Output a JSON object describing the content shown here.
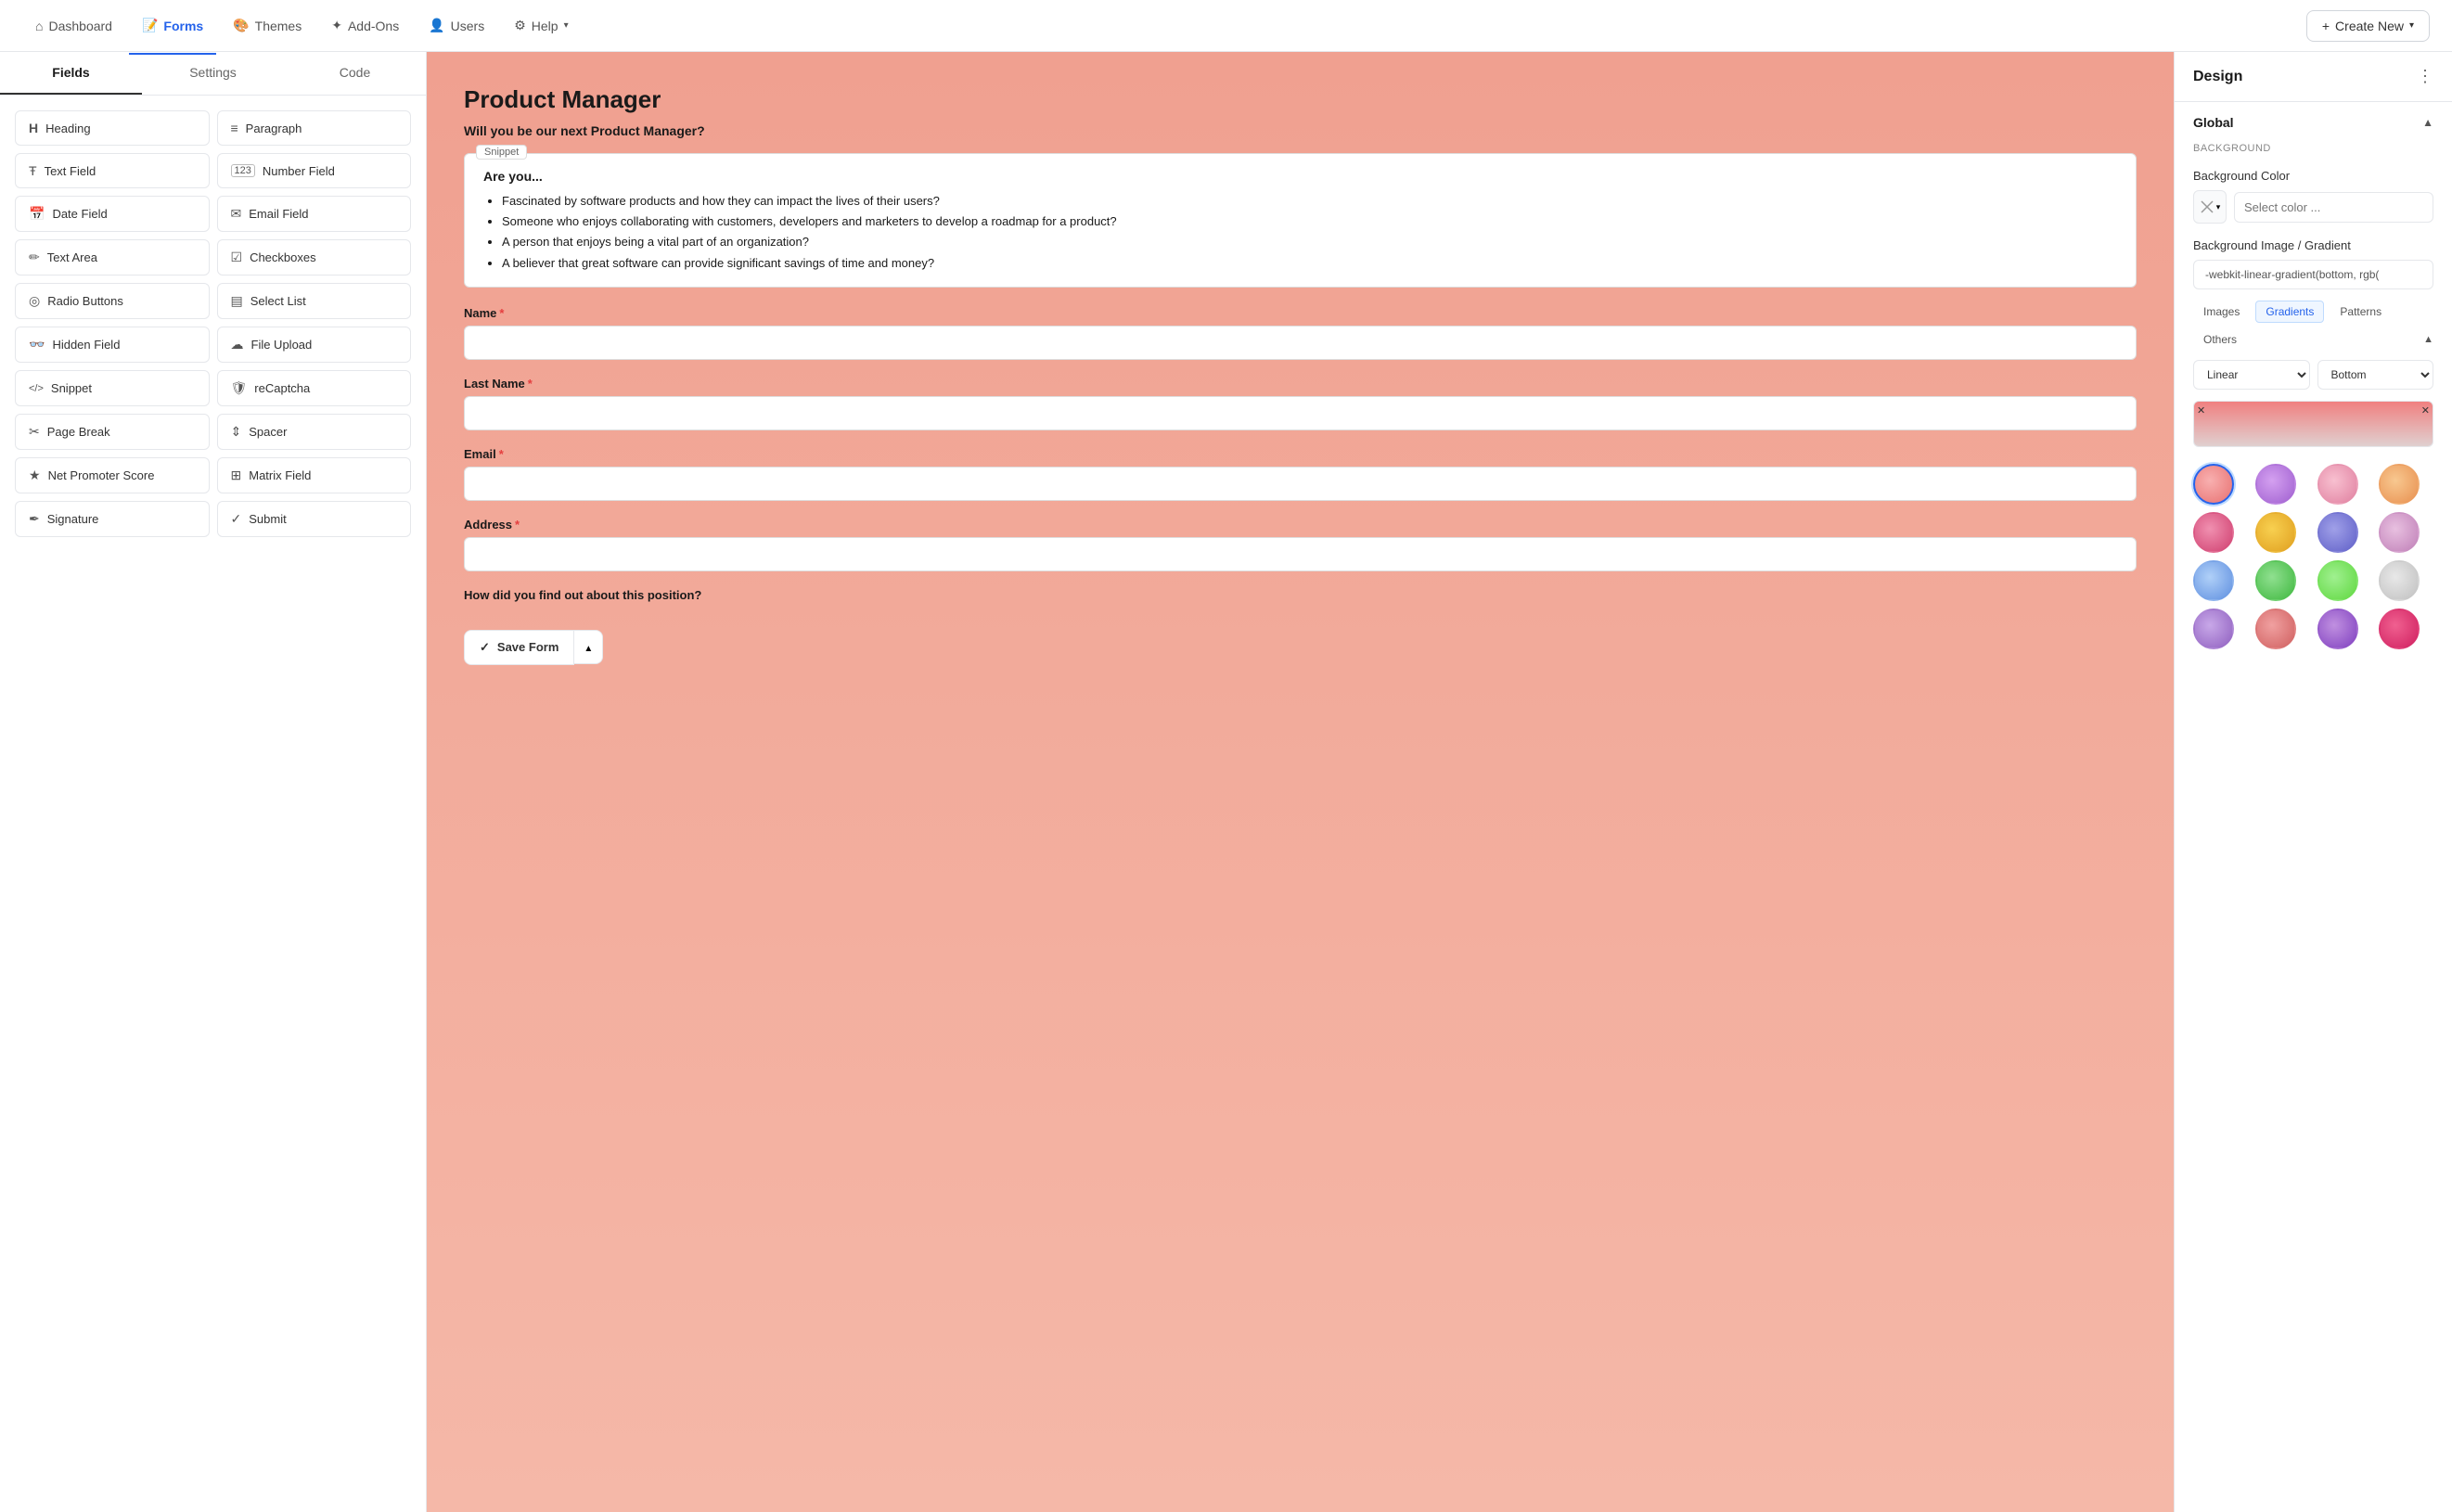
{
  "nav": {
    "items": [
      {
        "label": "Dashboard",
        "icon": "⌂",
        "active": false
      },
      {
        "label": "Forms",
        "icon": "📋",
        "active": true
      },
      {
        "label": "Themes",
        "icon": "🎨",
        "active": false
      },
      {
        "label": "Add-Ons",
        "icon": "✦",
        "active": false
      },
      {
        "label": "Users",
        "icon": "👤",
        "active": false
      },
      {
        "label": "Help",
        "icon": "⚙",
        "active": false
      }
    ],
    "create_new_label": "Create New"
  },
  "left_panel": {
    "tabs": [
      {
        "label": "Fields",
        "active": true
      },
      {
        "label": "Settings",
        "active": false
      },
      {
        "label": "Code",
        "active": false
      }
    ],
    "fields": [
      {
        "label": "Heading",
        "icon": "H"
      },
      {
        "label": "Paragraph",
        "icon": "≡"
      },
      {
        "label": "Text Field",
        "icon": "Ŧ"
      },
      {
        "label": "Number Field",
        "icon": "123"
      },
      {
        "label": "Date Field",
        "icon": "📅"
      },
      {
        "label": "Email Field",
        "icon": "✉"
      },
      {
        "label": "Text Area",
        "icon": "✏"
      },
      {
        "label": "Checkboxes",
        "icon": "☑"
      },
      {
        "label": "Radio Buttons",
        "icon": "◎"
      },
      {
        "label": "Select List",
        "icon": "▤"
      },
      {
        "label": "Hidden Field",
        "icon": "👓"
      },
      {
        "label": "File Upload",
        "icon": "☁"
      },
      {
        "label": "Snippet",
        "icon": "</>"
      },
      {
        "label": "reCaptcha",
        "icon": "🛡"
      },
      {
        "label": "Page Break",
        "icon": "✂"
      },
      {
        "label": "Spacer",
        "icon": "⇕"
      },
      {
        "label": "Net Promoter Score",
        "icon": "★"
      },
      {
        "label": "Matrix Field",
        "icon": "⊞"
      },
      {
        "label": "Signature",
        "icon": "✒"
      },
      {
        "label": "Submit",
        "icon": "✓"
      }
    ]
  },
  "form_preview": {
    "title": "Product Manager",
    "subtitle": "Will you be our next Product Manager?",
    "snippet": {
      "label": "Snippet",
      "heading": "Are you...",
      "bullets": [
        "Fascinated by software products and how they can impact the lives of their users?",
        "Someone who enjoys collaborating with customers, developers and marketers to develop a roadmap for a product?",
        "A person that enjoys being a vital part of an organization?",
        "A believer that great software can provide significant savings of time and money?"
      ]
    },
    "fields": [
      {
        "label": "Name",
        "required": true,
        "type": "input"
      },
      {
        "label": "Last Name",
        "required": true,
        "type": "input"
      },
      {
        "label": "Email",
        "required": true,
        "type": "input"
      },
      {
        "label": "Address",
        "required": true,
        "type": "input"
      },
      {
        "label": "How did you find out about this position?",
        "required": false,
        "type": "select"
      }
    ],
    "save_btn_label": "Save Form"
  },
  "right_panel": {
    "title": "Design",
    "section": "Global",
    "background_label": "Background",
    "bg_color_label": "Background Color",
    "bg_color_placeholder": "Select color ...",
    "gradient_label": "Background Image / Gradient",
    "gradient_value": "-webkit-linear-gradient(bottom, rgb(",
    "gradient_tabs": [
      "Images",
      "Gradients",
      "Patterns",
      "Others"
    ],
    "active_gradient_tab": "Gradients",
    "gradient_type_label": "Linear",
    "gradient_direction_label": "Bottom",
    "gradient_preview_colors": [
      "#f08080",
      "#e8e0e0"
    ],
    "swatches": [
      {
        "color": "#f4a0a0",
        "selected": true
      },
      {
        "color": "#c084e8",
        "selected": false
      },
      {
        "color": "#f0b8c8",
        "selected": false
      },
      {
        "color": "#f4b87a",
        "selected": false
      },
      {
        "color": "#e87a9a",
        "selected": false
      },
      {
        "color": "#f0b030",
        "selected": false
      },
      {
        "color": "#9090e0",
        "selected": false
      },
      {
        "color": "#e0b0d8",
        "selected": false
      },
      {
        "color": "#a0c0f0",
        "selected": false
      },
      {
        "color": "#80d880",
        "selected": false
      },
      {
        "color": "#80e870",
        "selected": false
      },
      {
        "color": "#d8d8d8",
        "selected": false
      },
      {
        "color": "#c0a0d8",
        "selected": false
      },
      {
        "color": "#f09898",
        "selected": false
      },
      {
        "color": "#b080d0",
        "selected": false
      },
      {
        "color": "#e83060",
        "selected": false
      }
    ]
  }
}
